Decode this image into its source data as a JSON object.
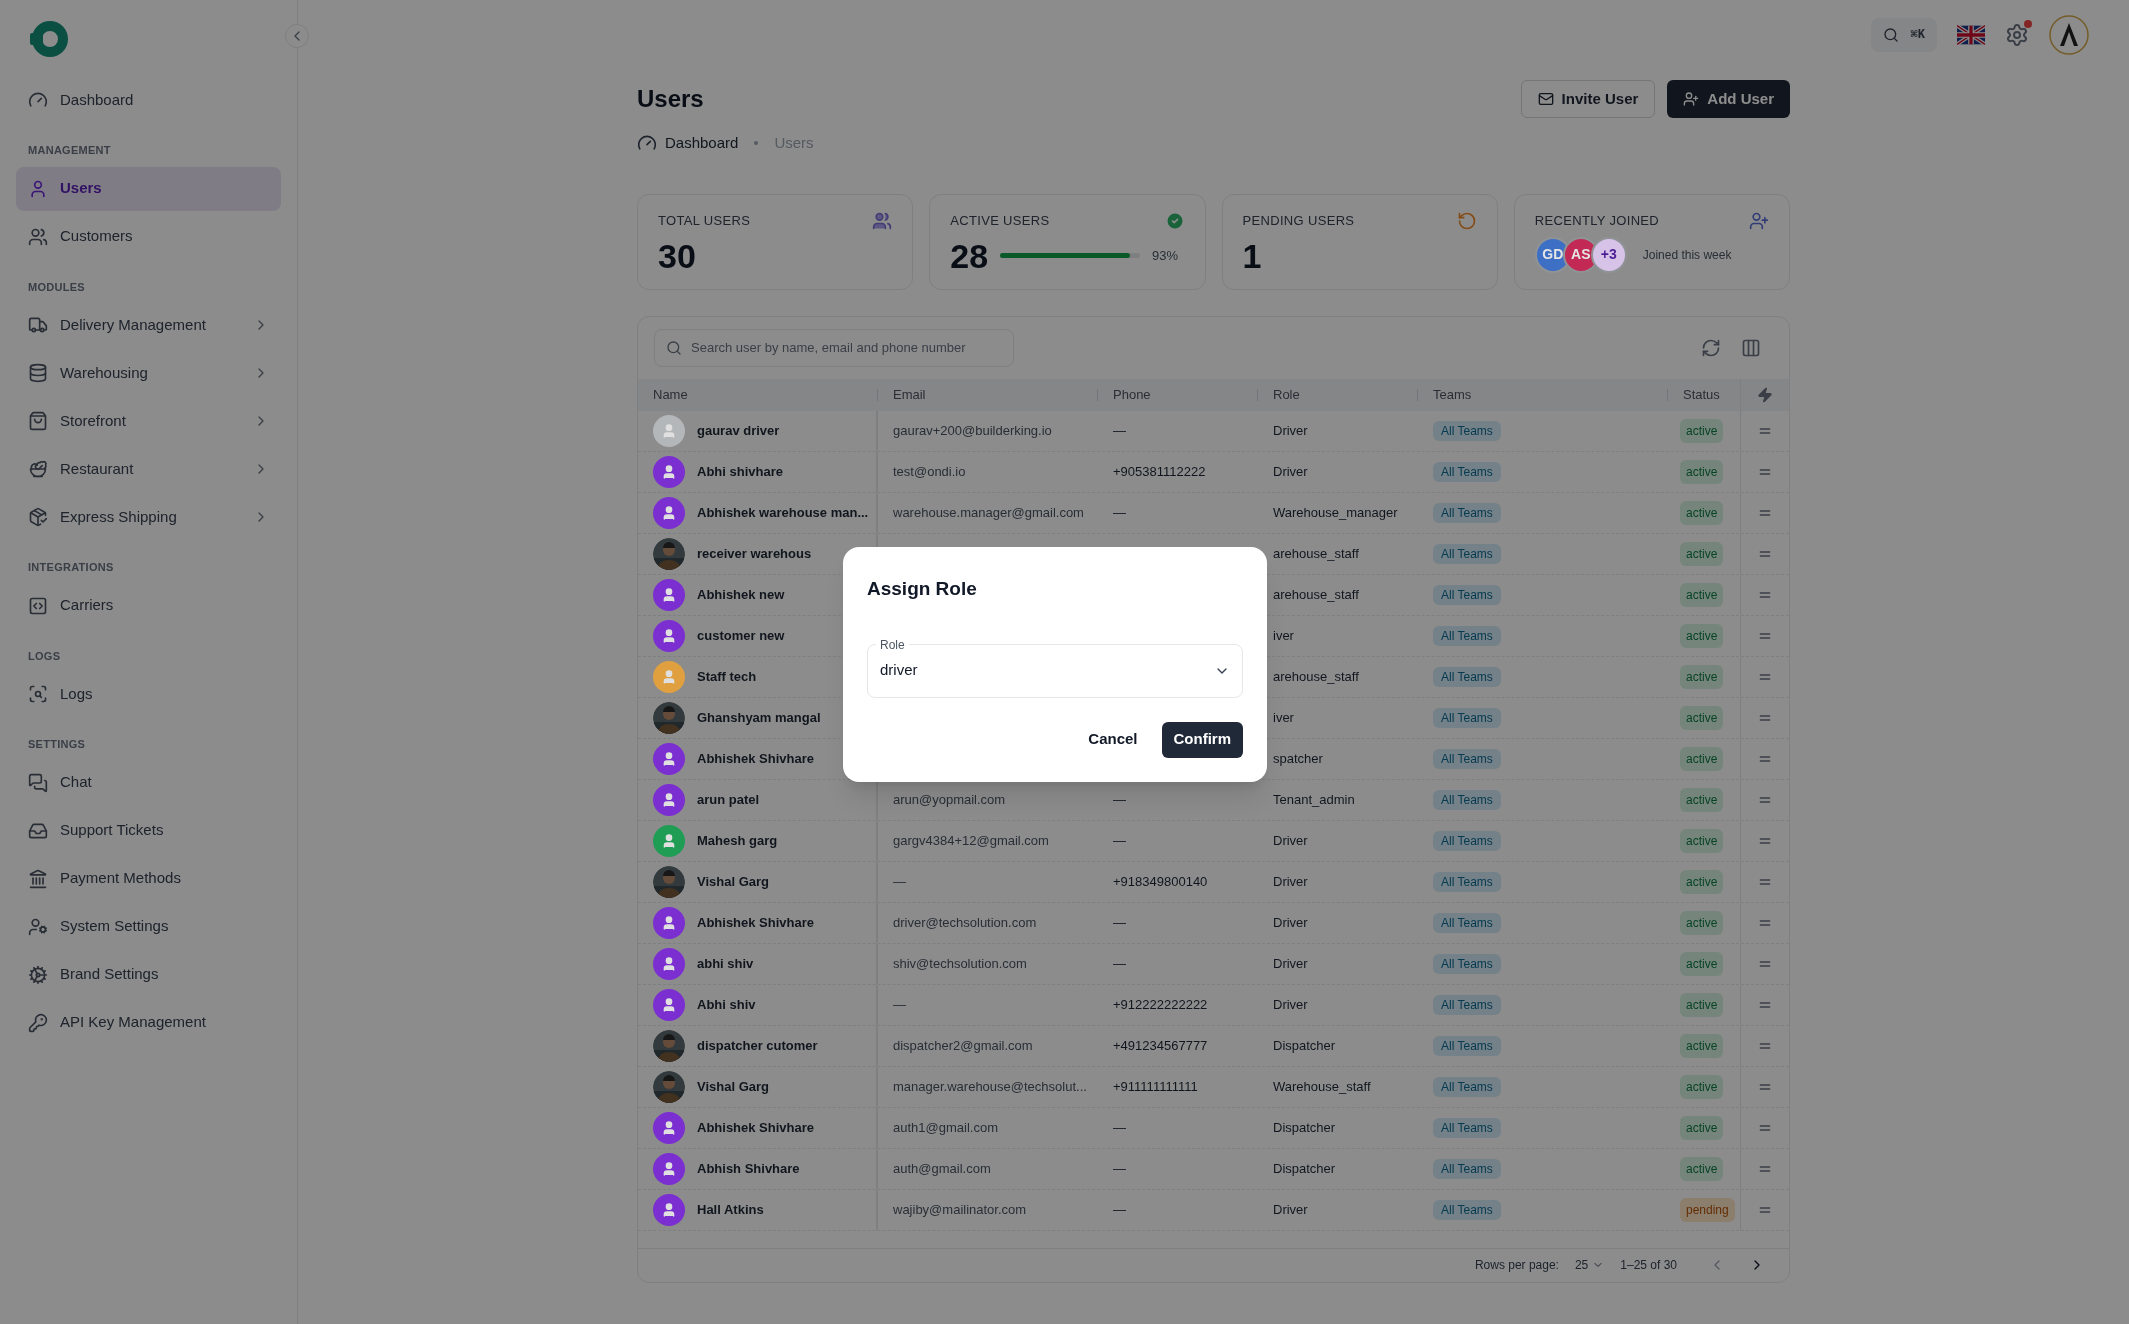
{
  "sidebar": {
    "top_items": [
      {
        "label": "Dashboard",
        "selected": false,
        "has_submenu": false
      }
    ],
    "sections": [
      {
        "title": "MANAGEMENT",
        "items": [
          {
            "label": "Users",
            "selected": true,
            "has_submenu": false
          },
          {
            "label": "Customers",
            "selected": false,
            "has_submenu": false
          }
        ]
      },
      {
        "title": "MODULES",
        "items": [
          {
            "label": "Delivery Management",
            "selected": false,
            "has_submenu": true
          },
          {
            "label": "Warehousing",
            "selected": false,
            "has_submenu": true
          },
          {
            "label": "Storefront",
            "selected": false,
            "has_submenu": true
          },
          {
            "label": "Restaurant",
            "selected": false,
            "has_submenu": true
          },
          {
            "label": "Express Shipping",
            "selected": false,
            "has_submenu": true
          }
        ]
      },
      {
        "title": "INTEGRATIONS",
        "items": [
          {
            "label": "Carriers",
            "selected": false,
            "has_submenu": false
          }
        ]
      },
      {
        "title": "LOGS",
        "items": [
          {
            "label": "Logs",
            "selected": false,
            "has_submenu": false
          }
        ]
      },
      {
        "title": "SETTINGS",
        "items": [
          {
            "label": "Chat",
            "selected": false,
            "has_submenu": false
          },
          {
            "label": "Support Tickets",
            "selected": false,
            "has_submenu": false
          },
          {
            "label": "Payment Methods",
            "selected": false,
            "has_submenu": false
          },
          {
            "label": "System Settings",
            "selected": false,
            "has_submenu": false
          },
          {
            "label": "Brand Settings",
            "selected": false,
            "has_submenu": false
          },
          {
            "label": "API Key Management",
            "selected": false,
            "has_submenu": false
          }
        ]
      }
    ]
  },
  "topbar": {
    "shortcut": "⌘K",
    "notification_dot": true
  },
  "page": {
    "title": "Users",
    "actions": [
      {
        "label": "Invite User",
        "kind": "outline"
      },
      {
        "label": "Add User",
        "kind": "primary"
      }
    ],
    "breadcrumb": [
      {
        "label": "Dashboard",
        "current": false
      },
      {
        "label": "Users",
        "current": true
      }
    ]
  },
  "stats": [
    {
      "kind": "count",
      "label": "TOTAL USERS",
      "value": "30"
    },
    {
      "kind": "progress",
      "label": "ACTIVE USERS",
      "value": "28",
      "level": 0.93,
      "reading": "93%"
    },
    {
      "kind": "count",
      "label": "PENDING USERS",
      "value": "1"
    },
    {
      "kind": "avatars",
      "label": "RECENTLY JOINED",
      "avatars": [
        {
          "initials": "GD",
          "color": "#3d6fc4"
        },
        {
          "initials": "AS",
          "color": "#c22a55"
        },
        {
          "initials": "+3",
          "color": "#d8c3e8"
        }
      ],
      "note": "Joined this week"
    }
  ],
  "table": {
    "search": {
      "placeholder": "Search user by name, email and phone number"
    },
    "columns": [
      "Name",
      "Email",
      "Phone",
      "Role",
      "Teams",
      "Status"
    ],
    "rows": [
      {
        "name": "gaurav driver",
        "avatar": {
          "kind": "icon",
          "color": "#b4b7ba"
        },
        "email": "gaurav+200@builderking.io",
        "phone": "—",
        "role": "Driver",
        "team": "All Teams",
        "status": {
          "label": "active",
          "kind": "active"
        }
      },
      {
        "name": "Abhi shivhare",
        "avatar": {
          "kind": "icon",
          "color": "#7b2fd0"
        },
        "email": "test@ondi.io",
        "phone": "+905381112222",
        "role": "Driver",
        "team": "All Teams",
        "status": {
          "label": "active",
          "kind": "active"
        }
      },
      {
        "name": "Abhishek warehouse man...",
        "avatar": {
          "kind": "icon",
          "color": "#7b2fd0"
        },
        "email": "warehouse.manager@gmail.com",
        "phone": "—",
        "role": "Warehouse_manager",
        "team": "All Teams",
        "status": {
          "label": "active",
          "kind": "active"
        }
      },
      {
        "name": "receiver warehous",
        "role": "arehouse_staff",
        "team": "All Teams",
        "status": {
          "label": "active",
          "kind": "active"
        }
      },
      {
        "name": "Abhishek new",
        "avatar": {
          "kind": "icon",
          "color": "#7b2fd0"
        },
        "role": "arehouse_staff",
        "team": "All Teams",
        "status": {
          "label": "active",
          "kind": "active"
        }
      },
      {
        "name": "customer new",
        "avatar": {
          "kind": "icon",
          "color": "#7b2fd0"
        },
        "role": "iver",
        "team": "All Teams",
        "status": {
          "label": "active",
          "kind": "active"
        }
      },
      {
        "name": "Staff tech",
        "avatar": {
          "kind": "icon",
          "color": "#e0a040"
        },
        "role": "arehouse_staff",
        "team": "All Teams",
        "status": {
          "label": "active",
          "kind": "active"
        }
      },
      {
        "name": "Ghanshyam mangal",
        "role": "iver",
        "team": "All Teams",
        "status": {
          "label": "active",
          "kind": "active"
        }
      },
      {
        "name": "Abhishek Shivhare",
        "avatar": {
          "kind": "icon",
          "color": "#7b2fd0"
        },
        "role": "spatcher",
        "team": "All Teams",
        "status": {
          "label": "active",
          "kind": "active"
        }
      },
      {
        "name": "arun patel",
        "avatar": {
          "kind": "icon",
          "color": "#7b2fd0"
        },
        "email": "arun@yopmail.com",
        "phone": "—",
        "role": "Tenant_admin",
        "team": "All Teams",
        "status": {
          "label": "active",
          "kind": "active"
        }
      },
      {
        "name": "Mahesh garg",
        "avatar": {
          "kind": "icon",
          "color": "#1f9d55"
        },
        "email": "gargv4384+12@gmail.com",
        "phone": "—",
        "role": "Driver",
        "team": "All Teams",
        "status": {
          "label": "active",
          "kind": "active"
        }
      },
      {
        "name": "Vishal Garg",
        "email": "—",
        "phone": "+918349800140",
        "role": "Driver",
        "team": "All Teams",
        "status": {
          "label": "active",
          "kind": "active"
        }
      },
      {
        "name": "Abhishek Shivhare",
        "avatar": {
          "kind": "icon",
          "color": "#7b2fd0"
        },
        "email": "driver@techsolution.com",
        "phone": "—",
        "role": "Driver",
        "team": "All Teams",
        "status": {
          "label": "active",
          "kind": "active"
        }
      },
      {
        "name": "abhi shiv",
        "avatar": {
          "kind": "icon",
          "color": "#7b2fd0"
        },
        "email": "shiv@techsolution.com",
        "phone": "—",
        "role": "Driver",
        "team": "All Teams",
        "status": {
          "label": "active",
          "kind": "active"
        }
      },
      {
        "name": "Abhi shiv",
        "avatar": {
          "kind": "icon",
          "color": "#7b2fd0"
        },
        "email": "—",
        "phone": "+912222222222",
        "role": "Driver",
        "team": "All Teams",
        "status": {
          "label": "active",
          "kind": "active"
        }
      },
      {
        "name": "dispatcher cutomer",
        "email": "dispatcher2@gmail.com",
        "phone": "+491234567777",
        "role": "Dispatcher",
        "team": "All Teams",
        "status": {
          "label": "active",
          "kind": "active"
        }
      },
      {
        "name": "Vishal Garg",
        "email": "manager.warehouse@techsolut...",
        "phone": "+911111111111",
        "role": "Warehouse_staff",
        "team": "All Teams",
        "status": {
          "label": "active",
          "kind": "active"
        }
      },
      {
        "name": "Abhishek Shivhare",
        "avatar": {
          "kind": "icon",
          "color": "#7b2fd0"
        },
        "email": "auth1@gmail.com",
        "phone": "—",
        "role": "Dispatcher",
        "team": "All Teams",
        "status": {
          "label": "active",
          "kind": "active"
        }
      },
      {
        "name": "Abhish Shivhare",
        "avatar": {
          "kind": "icon",
          "color": "#7b2fd0"
        },
        "email": "auth@gmail.com",
        "phone": "—",
        "role": "Dispatcher",
        "team": "All Teams",
        "status": {
          "label": "active",
          "kind": "active"
        }
      },
      {
        "name": "Hall Atkins",
        "avatar": {
          "kind": "icon",
          "color": "#7b2fd0"
        },
        "email": "wajiby@mailinator.com",
        "phone": "—",
        "role": "Driver",
        "team": "All Teams",
        "status": {
          "label": "pending",
          "kind": "pending"
        }
      }
    ],
    "pagination": {
      "rows_label": "Rows per page:",
      "rows_value": "25",
      "range": "1–25 of 30"
    }
  },
  "dialog": {
    "title": "Assign Role",
    "field": {
      "label": "Role",
      "value": "driver"
    },
    "buttons": [
      {
        "label": "Cancel",
        "kind": "text"
      },
      {
        "label": "Confirm",
        "kind": "primary"
      }
    ]
  }
}
